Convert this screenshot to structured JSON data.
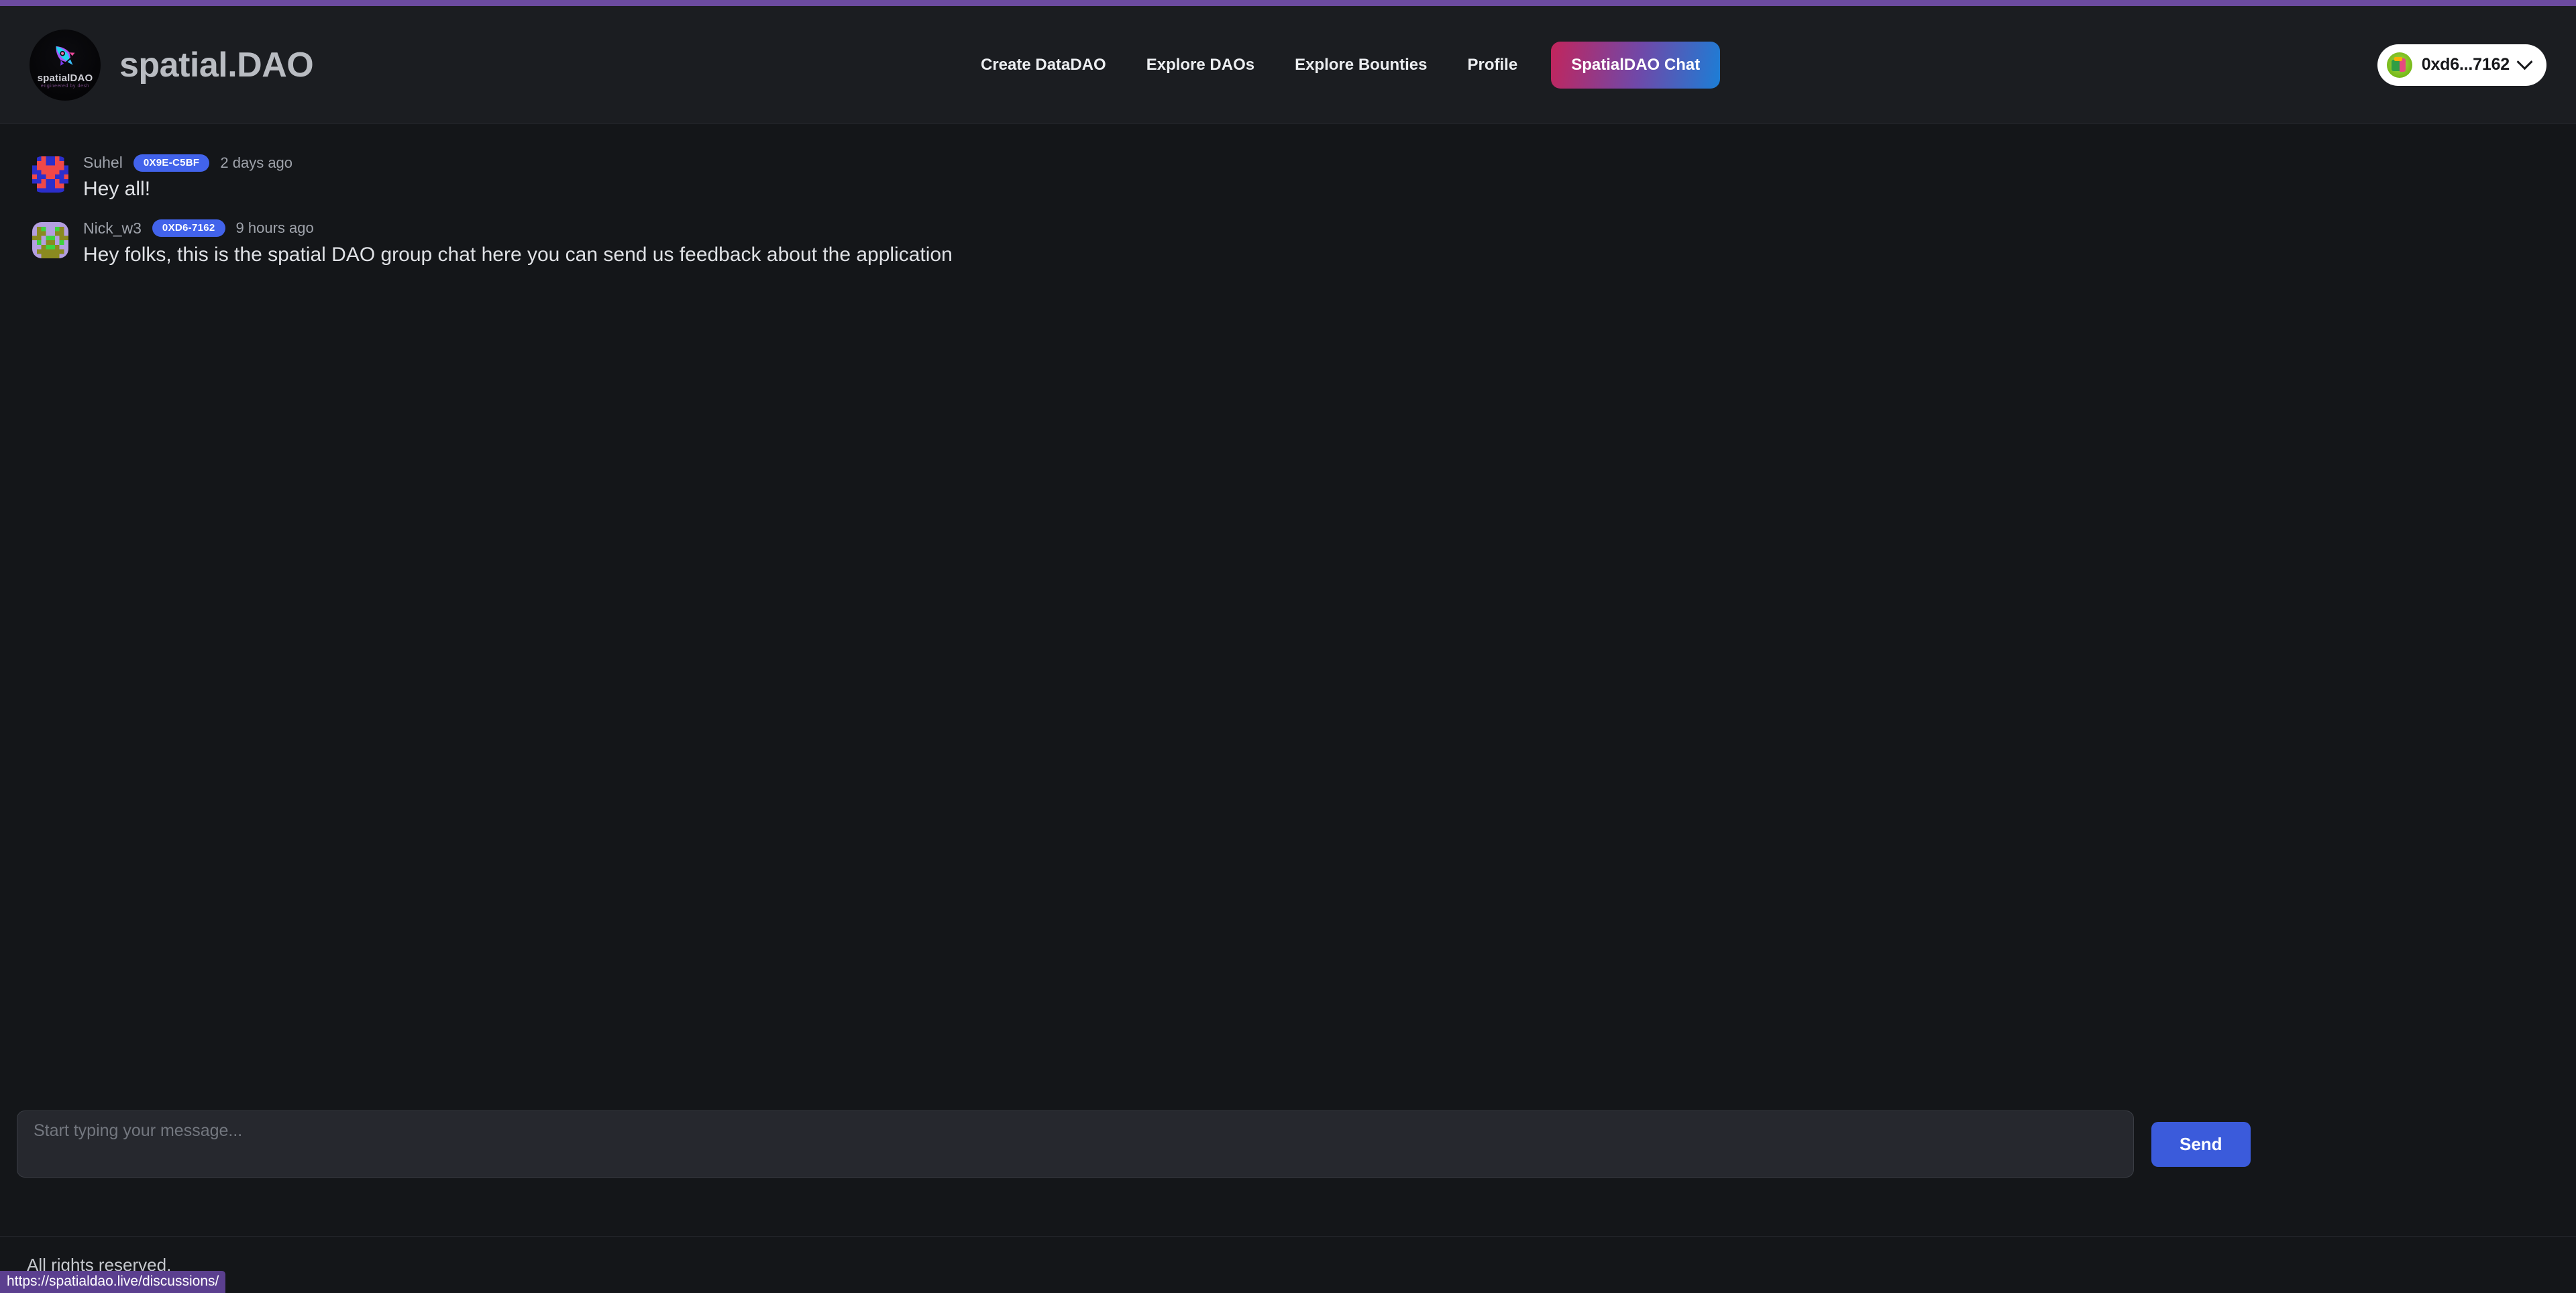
{
  "browser": {
    "status_url": "https://spatialdao.live/discussions/"
  },
  "theme": {
    "page_background": "#141619",
    "header_background": "#1b1d21",
    "accent_blue": "#3b5bdb",
    "badge_blue": "#4263eb",
    "top_strip_purple": "#6c4ba0",
    "cta_gradient_from": "#c2255c",
    "cta_gradient_to": "#1c7ed6",
    "status_url_purple": "#5b3f8f"
  },
  "header": {
    "logo": {
      "icon": "rocket-icon",
      "wordmark": "spatialDAO",
      "tagline": "engineered by desh"
    },
    "brand_name": "spatial.DAO",
    "nav": [
      {
        "label": "Create DataDAO",
        "name": "nav-create-datadao",
        "active": false
      },
      {
        "label": "Explore DAOs",
        "name": "nav-explore-daos",
        "active": false
      },
      {
        "label": "Explore Bounties",
        "name": "nav-explore-bounties",
        "active": false
      },
      {
        "label": "Profile",
        "name": "nav-profile",
        "active": false
      }
    ],
    "cta": {
      "label": "SpatialDAO Chat",
      "active": true
    },
    "wallet": {
      "address": "0xd6...7162",
      "avatar_icon": "wallet-avatar-icon",
      "chevron_icon": "chevron-down-icon"
    }
  },
  "chat": {
    "messages": [
      {
        "author": "Suhel",
        "badge": "0X9E-C5BF",
        "time": "2 days ago",
        "text": "Hey all!",
        "avatar_colors": [
          "#2b2ecb",
          "#f04848",
          "#151515"
        ]
      },
      {
        "author": "Nick_w3",
        "badge": "0XD6-7162",
        "time": "9 hours ago",
        "text": "Hey folks, this is the spatial DAO group chat here you can send us feedback about the application",
        "avatar_colors": [
          "#b49fe0",
          "#8a8a20",
          "#3fd23f"
        ]
      }
    ]
  },
  "composer": {
    "placeholder": "Start typing your message...",
    "value": "",
    "send_label": "Send"
  },
  "footer": {
    "text": "All rights reserved."
  }
}
